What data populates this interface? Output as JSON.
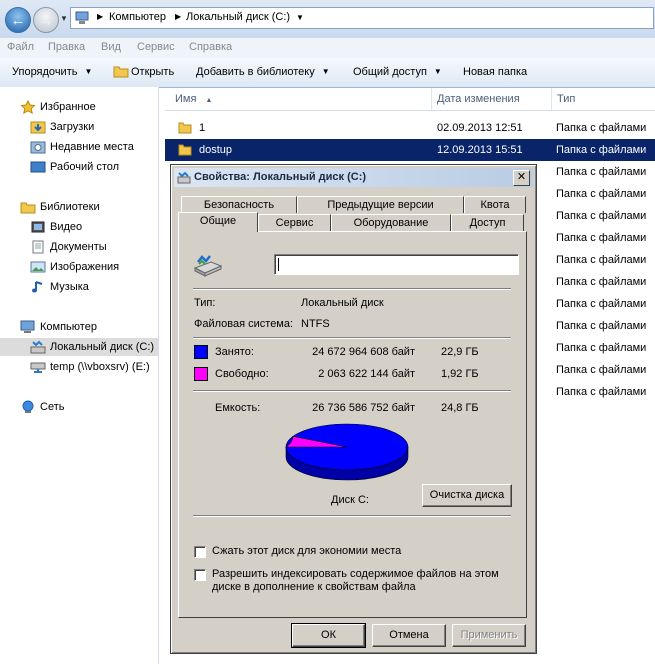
{
  "explorer": {
    "breadcrumb": [
      "Компьютер",
      "Локальный диск (C:)"
    ],
    "menu": [
      "Файл",
      "Правка",
      "Вид",
      "Сервис",
      "Справка"
    ],
    "toolbar": {
      "organize": "Упорядочить",
      "open": "Открыть",
      "add_to_library": "Добавить в библиотеку",
      "share": "Общий доступ",
      "new_folder": "Новая папка"
    },
    "nav": {
      "favorites": "Избранное",
      "downloads": "Загрузки",
      "recent": "Недавние места",
      "desktop": "Рабочий стол",
      "libraries": "Библиотеки",
      "video": "Видео",
      "documents": "Документы",
      "pictures": "Изображения",
      "music": "Музыка",
      "computer": "Компьютер",
      "local_disk": "Локальный диск (C:)",
      "temp": "temp (\\\\vboxsrv) (E:)",
      "network": "Сеть"
    },
    "columns": {
      "name": "Имя",
      "date": "Дата изменения",
      "type": "Тип"
    },
    "files": [
      {
        "name": "1",
        "date": "02.09.2013 12:51",
        "type": "Папка с файлами"
      },
      {
        "name": "dostup",
        "date": "12.09.2013 15:51",
        "type": "Папка с файлами"
      },
      {
        "name": "",
        "date": "",
        "type": "Папка с файлами"
      },
      {
        "name": "",
        "date": "",
        "type": "Папка с файлами"
      },
      {
        "name": "",
        "date": "",
        "type": "Папка с файлами"
      },
      {
        "name": "",
        "date": "",
        "type": "Папка с файлами"
      },
      {
        "name": "",
        "date": "",
        "type": "Папка с файлами"
      },
      {
        "name": "",
        "date": "",
        "type": "Папка с файлами"
      },
      {
        "name": "",
        "date": "",
        "type": "Папка с файлами"
      },
      {
        "name": "",
        "date": "",
        "type": "Папка с файлами"
      },
      {
        "name": "",
        "date": "",
        "type": "Папка с файлами"
      },
      {
        "name": "",
        "date": "",
        "type": "Папка с файлами"
      },
      {
        "name": "",
        "date": "",
        "type": "Папка с файлами"
      }
    ]
  },
  "dialog": {
    "title": "Свойства: Локальный диск (C:)",
    "close": "✕",
    "tabs_row1": [
      "Безопасность",
      "Предыдущие версии",
      "Квота"
    ],
    "tabs_row2": [
      "Общие",
      "Сервис",
      "Оборудование",
      "Доступ"
    ],
    "name_value": "",
    "type_label": "Тип:",
    "type_value": "Локальный диск",
    "fs_label": "Файловая система:",
    "fs_value": "NTFS",
    "used_label": "Занято:",
    "used_bytes": "24 672 964 608 байт",
    "used_gb": "22,9 ГБ",
    "free_label": "Свободно:",
    "free_bytes": "2 063 622 144 байт",
    "free_gb": "1,92 ГБ",
    "capacity_label": "Емкость:",
    "capacity_bytes": "26 736 586 752 байт",
    "capacity_gb": "24,8 ГБ",
    "disk_label": "Диск C:",
    "cleanup_button": "Очистка диска",
    "compress_label": "Сжать этот диск для экономии места",
    "index_label_1": "Разрешить индексировать содержимое файлов на этом",
    "index_label_2": "диске в дополнение к свойствам файла",
    "ok": "ОК",
    "cancel": "Отмена",
    "apply": "Применить",
    "used_color": "#0000ff",
    "free_color": "#ff00ff",
    "used_fraction": 0.9228
  }
}
